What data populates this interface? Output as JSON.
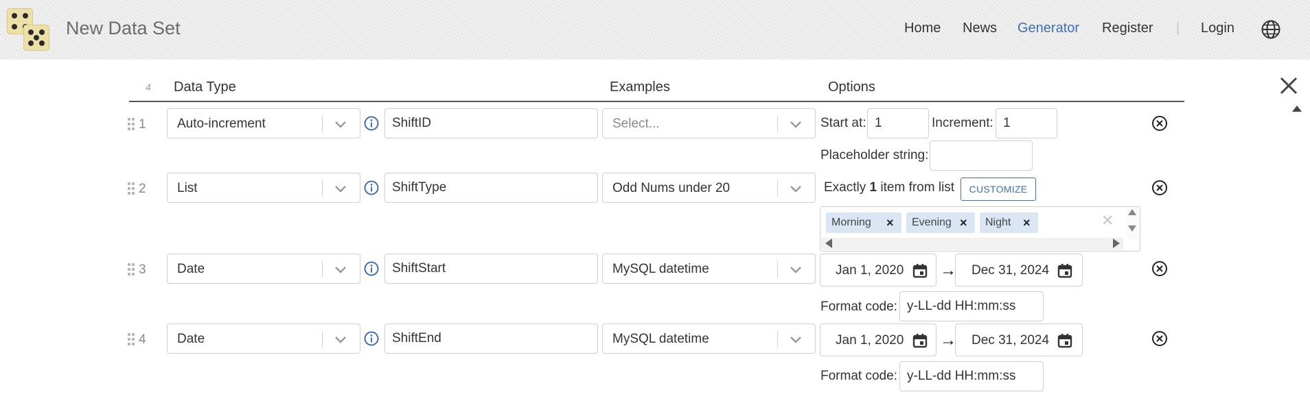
{
  "app": {
    "title": "New Data Set"
  },
  "nav": {
    "home": "Home",
    "news": "News",
    "generator": "Generator",
    "register": "Register",
    "separator": "|",
    "login": "Login"
  },
  "colors": {
    "accent": "#3f6fb3",
    "tag_bg": "#dbe6f5",
    "header_bg": "#ececec"
  },
  "icons": {
    "globe": "globe-icon",
    "close": "close-icon",
    "remove_row": "remove-circle-icon",
    "info": "info-icon",
    "calendar": "calendar-icon",
    "drag": "drag-handle-icon"
  },
  "grid": {
    "row_count": "4",
    "headers": {
      "data_type": "Data Type",
      "examples": "Examples",
      "options": "Options"
    }
  },
  "rows": [
    {
      "num": "1",
      "data_type": "Auto-increment",
      "field_name": "ShiftID",
      "example": "Select...",
      "options": {
        "start_label": "Start at:",
        "start_value": "1",
        "increment_label": "Increment:",
        "increment_value": "1",
        "placeholder_label": "Placeholder string:",
        "placeholder_value": ""
      }
    },
    {
      "num": "2",
      "data_type": "List",
      "field_name": "ShiftType",
      "example": "Odd Nums under 20",
      "options": {
        "exactly_prefix": "Exactly",
        "exactly_count": "1",
        "exactly_suffix": "item from list",
        "customize_label": "CUSTOMIZE",
        "items": [
          "Morning",
          "Evening",
          "Night"
        ],
        "item_remove": "×",
        "clear": "✕"
      }
    },
    {
      "num": "3",
      "data_type": "Date",
      "field_name": "ShiftStart",
      "example": "MySQL datetime",
      "options": {
        "from": "Jan 1, 2020",
        "to": "Dec 31, 2024",
        "arrow": "→",
        "format_label": "Format code:",
        "format_value": "y-LL-dd HH:mm:ss"
      }
    },
    {
      "num": "4",
      "data_type": "Date",
      "field_name": "ShiftEnd",
      "example": "MySQL datetime",
      "options": {
        "from": "Jan 1, 2020",
        "to": "Dec 31, 2024",
        "arrow": "→",
        "format_label": "Format code:",
        "format_value": "y-LL-dd HH:mm:ss"
      }
    }
  ]
}
